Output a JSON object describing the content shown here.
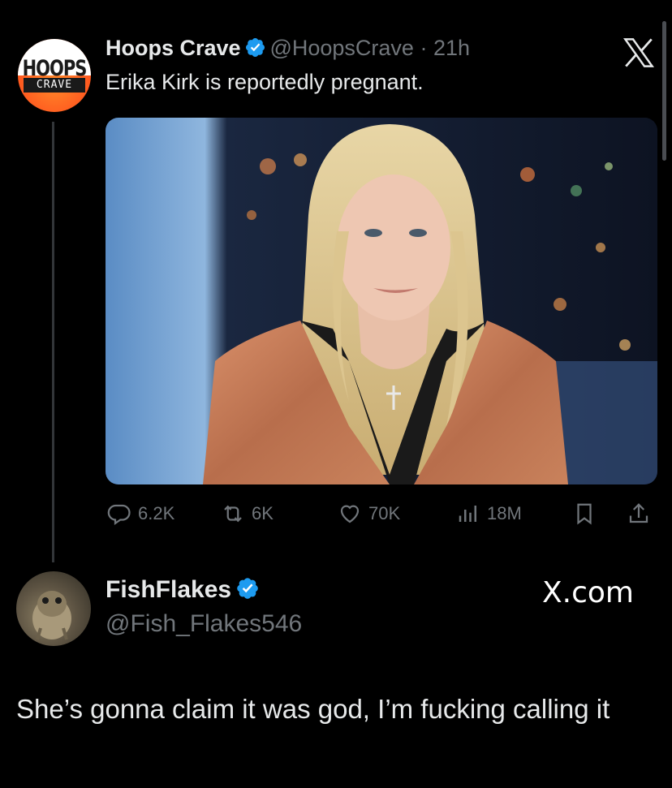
{
  "tweet": {
    "display_name": "Hoops Crave",
    "handle_time": "@HoopsCrave · 21h",
    "text": "Erika Kirk is reportedly pregnant.",
    "avatar_text_top": "HOOPS",
    "avatar_text_bottom": "CRAVE",
    "stats": {
      "replies": "6.2K",
      "reposts": "6K",
      "likes": "70K",
      "views": "18M"
    }
  },
  "reply": {
    "display_name": "FishFlakes",
    "handle": "@Fish_Flakes546",
    "watermark": "X.com",
    "text": "She’s gonna claim it was god, I’m fucking calling it"
  },
  "icons": [
    "x-logo-icon",
    "verified-badge-icon",
    "reply-icon",
    "repost-icon",
    "like-icon",
    "views-icon",
    "bookmark-icon",
    "share-icon"
  ],
  "colors": {
    "background": "#000000",
    "text_primary": "#e7e9ea",
    "text_secondary": "#71767b",
    "verified": "#1d9bf0"
  }
}
